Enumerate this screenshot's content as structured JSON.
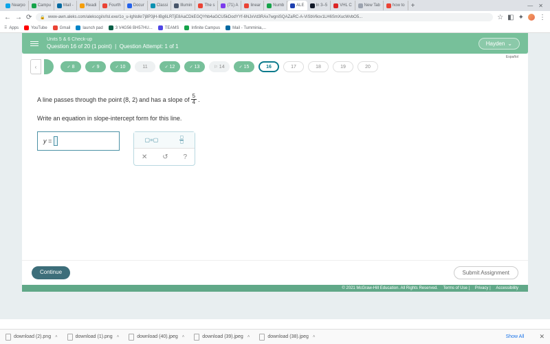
{
  "browser": {
    "tabs": [
      {
        "label": "Nearpo",
        "color": "#0ea5e9"
      },
      {
        "label": "Campu",
        "color": "#16a34a"
      },
      {
        "label": "Mail -",
        "color": "#0369a1"
      },
      {
        "label": "Readi",
        "color": "#f59e0b"
      },
      {
        "label": "Fourth",
        "color": "#ea4335"
      },
      {
        "label": "Docur",
        "color": "#2563eb"
      },
      {
        "label": "Classi",
        "color": "#0891b2"
      },
      {
        "label": "Illumin",
        "color": "#475569"
      },
      {
        "label": "The s",
        "color": "#ea4335"
      },
      {
        "label": "(71) A",
        "color": "#7c3aed"
      },
      {
        "label": "linear",
        "color": "#ea4335"
      },
      {
        "label": "Numb",
        "color": "#16a34a"
      },
      {
        "label": "ALE",
        "color": "#1e40af",
        "active": true
      },
      {
        "label": "In 3–5",
        "color": "#111827"
      },
      {
        "label": "VHL C",
        "color": "#dc2626"
      },
      {
        "label": "New Tab",
        "color": "#9ca3af"
      },
      {
        "label": "how to",
        "color": "#ea4335"
      }
    ],
    "url": "www-awn.aleks.com/alekscgi/x/Isl.exe/1o_u-IgNslkr7j8P3jH-IBg6LRTjE8AaCDkEGQYhb4aGCU5kDodYYf-6NJxVd3RAx7wgniSQAZaRC-A-ViSbV6ov1LH6SmXucWvbO5...",
    "bookmarks": [
      {
        "label": "Apps",
        "color": "#9ca3af"
      },
      {
        "label": "YouTube",
        "color": "#ff0000"
      },
      {
        "label": "Gmail",
        "color": "#ea4335"
      },
      {
        "label": "launch pad",
        "color": "#0284c7"
      },
      {
        "label": "3 V4G56 BH57HU...",
        "color": "#065f46"
      },
      {
        "label": "TEAMS",
        "color": "#4f46e5"
      },
      {
        "label": "Infinite Campus",
        "color": "#16a34a"
      },
      {
        "label": "Mail - Tumminia,...",
        "color": "#0369a1"
      }
    ]
  },
  "header": {
    "unit": "Units 5 & 6 Check-up",
    "question": "Question 16 of 20 (1 point)",
    "attempt": "Question Attempt: 1 of 1",
    "user": "Hayden"
  },
  "nav": {
    "espanol": "Español",
    "items": [
      {
        "n": "8",
        "state": "done"
      },
      {
        "n": "9",
        "state": "done"
      },
      {
        "n": "10",
        "state": "done"
      },
      {
        "n": "11",
        "state": "plain"
      },
      {
        "n": "12",
        "state": "done"
      },
      {
        "n": "13",
        "state": "done"
      },
      {
        "n": "14",
        "state": "flagged"
      },
      {
        "n": "15",
        "state": "done"
      },
      {
        "n": "16",
        "state": "current"
      },
      {
        "n": "17",
        "state": "future"
      },
      {
        "n": "18",
        "state": "future"
      },
      {
        "n": "19",
        "state": "future"
      },
      {
        "n": "20",
        "state": "future"
      }
    ]
  },
  "problem": {
    "prefix": "A line passes through the point ",
    "point": "(8, 2)",
    "mid": " and has a slope of ",
    "slope_num": "5",
    "slope_den": "4",
    "suffix": ".",
    "instruction": "Write an equation in slope-intercept form for this line.",
    "answer_prefix": "y =",
    "tool_eq": "▢=▢"
  },
  "footer": {
    "continue": "Continue",
    "submit": "Submit Assignment",
    "copyright": "© 2021 McGraw-Hill Education. All Rights Reserved.",
    "terms": "Terms of Use",
    "privacy": "Privacy",
    "access": "Accessibility"
  },
  "downloads": {
    "items": [
      "download (2).png",
      "download (1).png",
      "download (40).jpeg",
      "download (39).jpeg",
      "download (38).jpeg"
    ],
    "showall": "Show All"
  }
}
